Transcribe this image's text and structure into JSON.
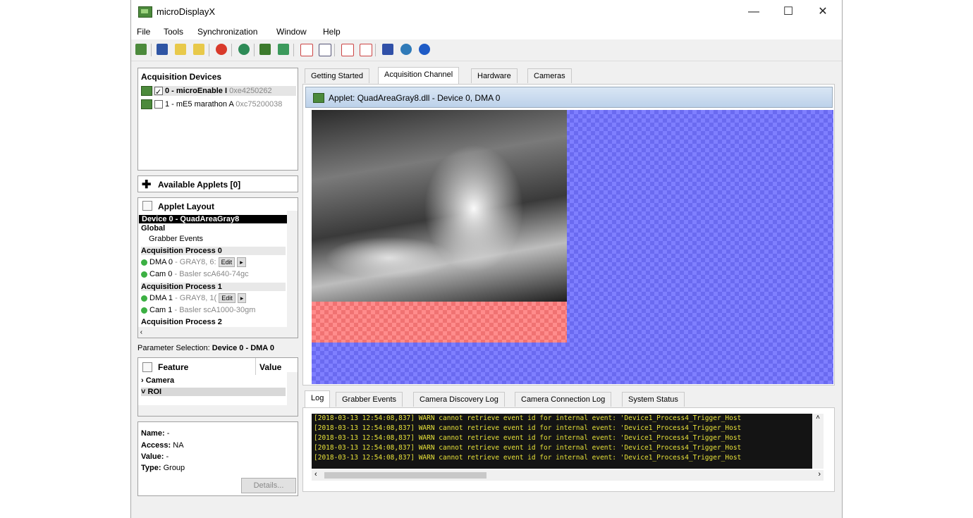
{
  "window": {
    "title": "microDisplayX",
    "min": "—",
    "max": "☐",
    "close": "✕"
  },
  "menu": [
    "File",
    "Tools",
    "Synchronization",
    "Window",
    "Help"
  ],
  "acq_devices": {
    "header": "Acquisition Devices",
    "items": [
      {
        "label": "0 - microEnable I",
        "serial": "0xe4250262",
        "checked": true
      },
      {
        "label": "1 - mE5 marathon A",
        "serial": "0xc75200038",
        "checked": false
      }
    ]
  },
  "available_applets": {
    "label": "Available Applets [0]"
  },
  "applet_layout": {
    "header": "Applet Layout",
    "selected": "Device 0 - QuadAreaGray8",
    "global": "Global",
    "grabber_events": "Grabber Events",
    "proc0": "Acquisition Process 0",
    "dma0": "DMA 0",
    "dma0_info": "- GRAY8, 6:",
    "cam0": "Cam 0",
    "cam0_info": "- Basler scA640-74gc",
    "proc1": "Acquisition Process 1",
    "dma1": "DMA 1",
    "dma1_info": "- GRAY8, 1(",
    "cam1": "Cam 1",
    "cam1_info": "- Basler scA1000-30gm",
    "proc2": "Acquisition Process 2",
    "edit": "Edit"
  },
  "param_selection": {
    "label": "Parameter Selection:",
    "value": "Device 0 - DMA 0"
  },
  "feature_tree": {
    "col_feature": "Feature",
    "col_value": "Value",
    "camera": "Camera",
    "roi": "ROI"
  },
  "details": {
    "name_label": "Name:",
    "name_value": "-",
    "access_label": "Access:",
    "access_value": "NA",
    "value_label": "Value:",
    "value_value": "-",
    "type_label": "Type:",
    "type_value": "Group",
    "button": "Details..."
  },
  "main_tabs": [
    "Getting Started",
    "Acquisition Channel",
    "Hardware",
    "Cameras"
  ],
  "main_tab_active": "Acquisition Channel",
  "viewer": {
    "title": "Applet: QuadAreaGray8.dll - Device 0, DMA 0"
  },
  "log_tabs": [
    "Log",
    "Grabber Events",
    "Camera Discovery Log",
    "Camera Connection Log",
    "System Status"
  ],
  "log_tab_active": "Log",
  "log_lines": [
    "[2018-03-13 12:54:08,837] WARN cannot retrieve event id for internal event: 'Device1_Process4_Trigger_Host",
    "[2018-03-13 12:54:08,837] WARN cannot retrieve event id for internal event: 'Device1_Process4_Trigger_Host",
    "[2018-03-13 12:54:08,837] WARN cannot retrieve event id for internal event: 'Device1_Process4_Trigger_Host",
    "[2018-03-13 12:54:08,837] WARN cannot retrieve event id for internal event: 'Device1_Process4_Trigger_Host",
    "[2018-03-13 12:54:08,837] WARN cannot retrieve event id for internal event: 'Device1_Process4_Trigger_Host"
  ],
  "colors": {
    "accent_blue": "#7f7fff",
    "overlay_red": "#ff8c8c",
    "log_text": "#e8e23a",
    "log_bg": "#141414"
  }
}
